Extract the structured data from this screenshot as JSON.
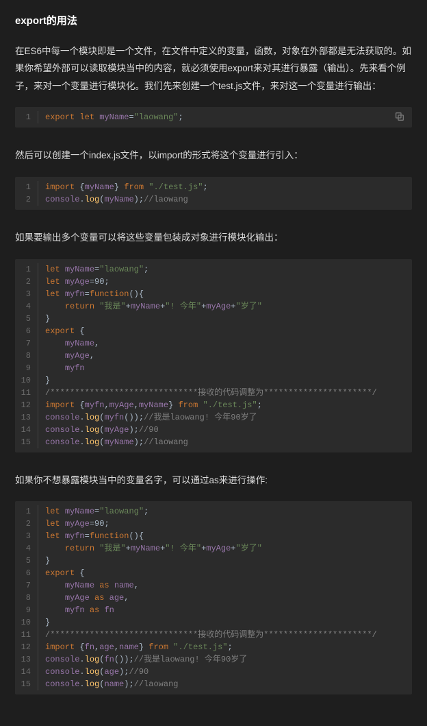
{
  "heading": "export的用法",
  "para1": "在ES6中每一个模块即是一个文件，在文件中定义的变量，函数，对象在外部都是无法获取的。如果你希望外部可以读取模块当中的内容，就必须使用export来对其进行暴露（输出）。先来看个例子，来对一个变量进行模块化。我们先来创建一个test.js文件，来对这一个变量进行输出：",
  "para2": "然后可以创建一个index.js文件，以import的形式将这个变量进行引入：",
  "para3": "如果要输出多个变量可以将这些变量包装成对象进行模块化输出：",
  "para4": "如果你不想暴露模块当中的变量名字，可以通过as来进行操作:",
  "copy_icon_name": "copy-icon",
  "code1": [
    [
      {
        "t": "export ",
        "c": "kw"
      },
      {
        "t": "let ",
        "c": "kw"
      },
      {
        "t": "myName",
        "c": "var"
      },
      {
        "t": "=",
        "c": "pl"
      },
      {
        "t": "\"laowang\"",
        "c": "str"
      },
      {
        "t": ";",
        "c": "pl"
      }
    ]
  ],
  "code2": [
    [
      {
        "t": "import ",
        "c": "kw"
      },
      {
        "t": "{",
        "c": "pl"
      },
      {
        "t": "myName",
        "c": "var"
      },
      {
        "t": "} ",
        "c": "pl"
      },
      {
        "t": "from ",
        "c": "kw"
      },
      {
        "t": "\"./test.js\"",
        "c": "str"
      },
      {
        "t": ";",
        "c": "pl"
      }
    ],
    [
      {
        "t": "console",
        "c": "var"
      },
      {
        "t": ".",
        "c": "pl"
      },
      {
        "t": "log",
        "c": "fn"
      },
      {
        "t": "(",
        "c": "pl"
      },
      {
        "t": "myName",
        "c": "var"
      },
      {
        "t": ");",
        "c": "pl"
      },
      {
        "t": "//laowang",
        "c": "cm"
      }
    ]
  ],
  "code3": [
    [
      {
        "t": "let ",
        "c": "kw"
      },
      {
        "t": "myName",
        "c": "var"
      },
      {
        "t": "=",
        "c": "pl"
      },
      {
        "t": "\"laowang\"",
        "c": "str"
      },
      {
        "t": ";",
        "c": "pl"
      }
    ],
    [
      {
        "t": "let ",
        "c": "kw"
      },
      {
        "t": "myAge",
        "c": "var"
      },
      {
        "t": "=",
        "c": "pl"
      },
      {
        "t": "90",
        "c": "pl"
      },
      {
        "t": ";",
        "c": "pl"
      }
    ],
    [
      {
        "t": "let ",
        "c": "kw"
      },
      {
        "t": "myfn",
        "c": "var"
      },
      {
        "t": "=",
        "c": "pl"
      },
      {
        "t": "function",
        "c": "kw"
      },
      {
        "t": "(){",
        "c": "pl"
      }
    ],
    [
      {
        "t": "    ",
        "c": "pl"
      },
      {
        "t": "return ",
        "c": "kw"
      },
      {
        "t": "\"我是\"",
        "c": "str"
      },
      {
        "t": "+",
        "c": "pl"
      },
      {
        "t": "myName",
        "c": "var"
      },
      {
        "t": "+",
        "c": "pl"
      },
      {
        "t": "\"! 今年\"",
        "c": "str"
      },
      {
        "t": "+",
        "c": "pl"
      },
      {
        "t": "myAge",
        "c": "var"
      },
      {
        "t": "+",
        "c": "pl"
      },
      {
        "t": "\"岁了\"",
        "c": "str"
      }
    ],
    [
      {
        "t": "}",
        "c": "pl"
      }
    ],
    [
      {
        "t": "export ",
        "c": "kw"
      },
      {
        "t": "{",
        "c": "pl"
      }
    ],
    [
      {
        "t": "    ",
        "c": "pl"
      },
      {
        "t": "myName",
        "c": "var"
      },
      {
        "t": ",",
        "c": "pl"
      }
    ],
    [
      {
        "t": "    ",
        "c": "pl"
      },
      {
        "t": "myAge",
        "c": "var"
      },
      {
        "t": ",",
        "c": "pl"
      }
    ],
    [
      {
        "t": "    ",
        "c": "pl"
      },
      {
        "t": "myfn",
        "c": "var"
      }
    ],
    [
      {
        "t": "}",
        "c": "pl"
      }
    ],
    [
      {
        "t": "/******************************接收的代码调整为**********************/",
        "c": "cm"
      }
    ],
    [
      {
        "t": "import ",
        "c": "kw"
      },
      {
        "t": "{",
        "c": "pl"
      },
      {
        "t": "myfn",
        "c": "var"
      },
      {
        "t": ",",
        "c": "pl"
      },
      {
        "t": "myAge",
        "c": "var"
      },
      {
        "t": ",",
        "c": "pl"
      },
      {
        "t": "myName",
        "c": "var"
      },
      {
        "t": "} ",
        "c": "pl"
      },
      {
        "t": "from ",
        "c": "kw"
      },
      {
        "t": "\"./test.js\"",
        "c": "str"
      },
      {
        "t": ";",
        "c": "pl"
      }
    ],
    [
      {
        "t": "console",
        "c": "var"
      },
      {
        "t": ".",
        "c": "pl"
      },
      {
        "t": "log",
        "c": "fn"
      },
      {
        "t": "(",
        "c": "pl"
      },
      {
        "t": "myfn",
        "c": "var"
      },
      {
        "t": "());",
        "c": "pl"
      },
      {
        "t": "//我是laowang! 今年90岁了",
        "c": "cm"
      }
    ],
    [
      {
        "t": "console",
        "c": "var"
      },
      {
        "t": ".",
        "c": "pl"
      },
      {
        "t": "log",
        "c": "fn"
      },
      {
        "t": "(",
        "c": "pl"
      },
      {
        "t": "myAge",
        "c": "var"
      },
      {
        "t": ");",
        "c": "pl"
      },
      {
        "t": "//90",
        "c": "cm"
      }
    ],
    [
      {
        "t": "console",
        "c": "var"
      },
      {
        "t": ".",
        "c": "pl"
      },
      {
        "t": "log",
        "c": "fn"
      },
      {
        "t": "(",
        "c": "pl"
      },
      {
        "t": "myName",
        "c": "var"
      },
      {
        "t": ");",
        "c": "pl"
      },
      {
        "t": "//laowang",
        "c": "cm"
      }
    ]
  ],
  "code4": [
    [
      {
        "t": "let ",
        "c": "kw"
      },
      {
        "t": "myName",
        "c": "var"
      },
      {
        "t": "=",
        "c": "pl"
      },
      {
        "t": "\"laowang\"",
        "c": "str"
      },
      {
        "t": ";",
        "c": "pl"
      }
    ],
    [
      {
        "t": "let ",
        "c": "kw"
      },
      {
        "t": "myAge",
        "c": "var"
      },
      {
        "t": "=",
        "c": "pl"
      },
      {
        "t": "90",
        "c": "pl"
      },
      {
        "t": ";",
        "c": "pl"
      }
    ],
    [
      {
        "t": "let ",
        "c": "kw"
      },
      {
        "t": "myfn",
        "c": "var"
      },
      {
        "t": "=",
        "c": "pl"
      },
      {
        "t": "function",
        "c": "kw"
      },
      {
        "t": "(){",
        "c": "pl"
      }
    ],
    [
      {
        "t": "    ",
        "c": "pl"
      },
      {
        "t": "return ",
        "c": "kw"
      },
      {
        "t": "\"我是\"",
        "c": "str"
      },
      {
        "t": "+",
        "c": "pl"
      },
      {
        "t": "myName",
        "c": "var"
      },
      {
        "t": "+",
        "c": "pl"
      },
      {
        "t": "\"! 今年\"",
        "c": "str"
      },
      {
        "t": "+",
        "c": "pl"
      },
      {
        "t": "myAge",
        "c": "var"
      },
      {
        "t": "+",
        "c": "pl"
      },
      {
        "t": "\"岁了\"",
        "c": "str"
      }
    ],
    [
      {
        "t": "}",
        "c": "pl"
      }
    ],
    [
      {
        "t": "export ",
        "c": "kw"
      },
      {
        "t": "{",
        "c": "pl"
      }
    ],
    [
      {
        "t": "    ",
        "c": "pl"
      },
      {
        "t": "myName ",
        "c": "var"
      },
      {
        "t": "as ",
        "c": "kw"
      },
      {
        "t": "name",
        "c": "var"
      },
      {
        "t": ",",
        "c": "pl"
      }
    ],
    [
      {
        "t": "    ",
        "c": "pl"
      },
      {
        "t": "myAge ",
        "c": "var"
      },
      {
        "t": "as ",
        "c": "kw"
      },
      {
        "t": "age",
        "c": "var"
      },
      {
        "t": ",",
        "c": "pl"
      }
    ],
    [
      {
        "t": "    ",
        "c": "pl"
      },
      {
        "t": "myfn ",
        "c": "var"
      },
      {
        "t": "as ",
        "c": "kw"
      },
      {
        "t": "fn",
        "c": "var"
      }
    ],
    [
      {
        "t": "}",
        "c": "pl"
      }
    ],
    [
      {
        "t": "/******************************接收的代码调整为**********************/",
        "c": "cm"
      }
    ],
    [
      {
        "t": "import ",
        "c": "kw"
      },
      {
        "t": "{",
        "c": "pl"
      },
      {
        "t": "fn",
        "c": "var"
      },
      {
        "t": ",",
        "c": "pl"
      },
      {
        "t": "age",
        "c": "var"
      },
      {
        "t": ",",
        "c": "pl"
      },
      {
        "t": "name",
        "c": "var"
      },
      {
        "t": "} ",
        "c": "pl"
      },
      {
        "t": "from ",
        "c": "kw"
      },
      {
        "t": "\"./test.js\"",
        "c": "str"
      },
      {
        "t": ";",
        "c": "pl"
      }
    ],
    [
      {
        "t": "console",
        "c": "var"
      },
      {
        "t": ".",
        "c": "pl"
      },
      {
        "t": "log",
        "c": "fn"
      },
      {
        "t": "(",
        "c": "pl"
      },
      {
        "t": "fn",
        "c": "var"
      },
      {
        "t": "());",
        "c": "pl"
      },
      {
        "t": "//我是laowang! 今年90岁了",
        "c": "cm"
      }
    ],
    [
      {
        "t": "console",
        "c": "var"
      },
      {
        "t": ".",
        "c": "pl"
      },
      {
        "t": "log",
        "c": "fn"
      },
      {
        "t": "(",
        "c": "pl"
      },
      {
        "t": "age",
        "c": "var"
      },
      {
        "t": ");",
        "c": "pl"
      },
      {
        "t": "//90",
        "c": "cm"
      }
    ],
    [
      {
        "t": "console",
        "c": "var"
      },
      {
        "t": ".",
        "c": "pl"
      },
      {
        "t": "log",
        "c": "fn"
      },
      {
        "t": "(",
        "c": "pl"
      },
      {
        "t": "name",
        "c": "var"
      },
      {
        "t": ");",
        "c": "pl"
      },
      {
        "t": "//laowang",
        "c": "cm"
      }
    ]
  ]
}
